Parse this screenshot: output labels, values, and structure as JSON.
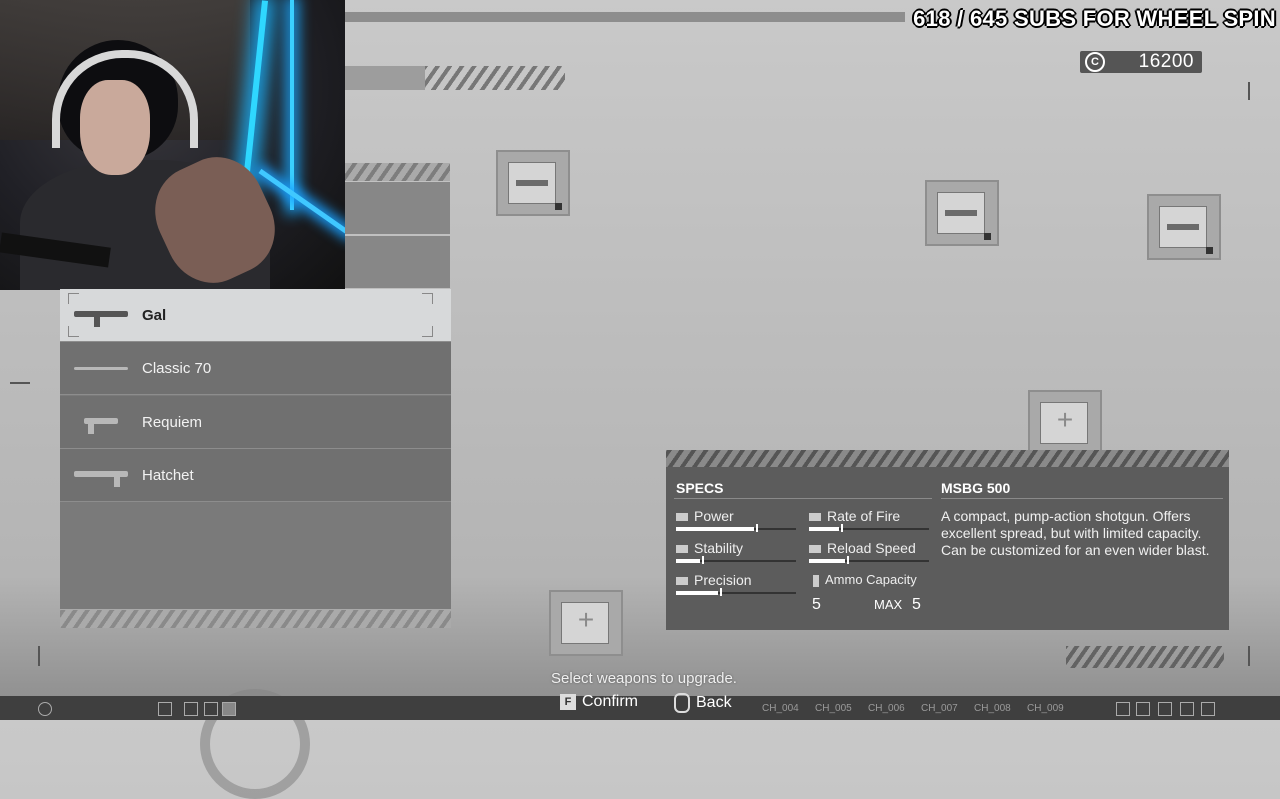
{
  "overlay": {
    "subs_text": "618 / 645 SUBS FOR WHEEL SPIN"
  },
  "header": {
    "credits_icon": "C",
    "credits": "16200"
  },
  "weapon_list": [
    {
      "name": "Gal",
      "selected": true
    },
    {
      "name": "Classic 70",
      "selected": false
    },
    {
      "name": "Requiem",
      "selected": false
    },
    {
      "name": "Hatchet",
      "selected": false
    }
  ],
  "specs": {
    "heading": "SPECS",
    "weapon_name": "MSBG 500",
    "description": "A compact, pump-action shotgun. Offers excellent spread, but with limited capacity. Can be customized for an even wider blast.",
    "stats": [
      {
        "label": "Power",
        "value": 0.65
      },
      {
        "label": "Rate of Fire",
        "value": 0.25
      },
      {
        "label": "Stability",
        "value": 0.2
      },
      {
        "label": "Reload Speed",
        "value": 0.3
      },
      {
        "label": "Precision",
        "value": 0.35
      }
    ],
    "ammo_label": "Ammo Capacity",
    "ammo_current": "5",
    "ammo_max_label": "MAX",
    "ammo_max": "5"
  },
  "footer": {
    "hint": "Select weapons to upgrade.",
    "confirm_key": "F",
    "confirm_label": "Confirm",
    "back_label": "Back",
    "channels": [
      "CH_004",
      "CH_005",
      "CH_006",
      "CH_007",
      "CH_008",
      "CH_009"
    ]
  }
}
